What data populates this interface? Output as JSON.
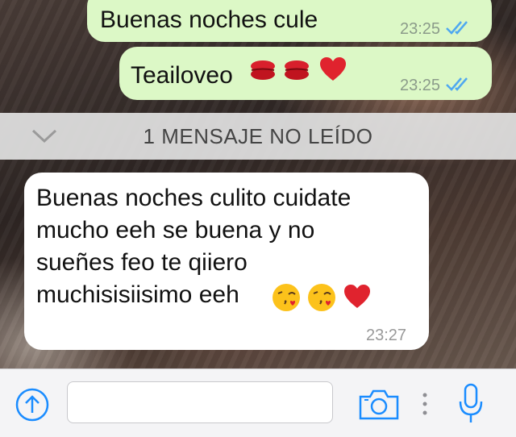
{
  "messages": [
    {
      "direction": "out",
      "text": "Buenas noches cule",
      "time": "23:25",
      "read": true
    },
    {
      "direction": "out",
      "text": "Teailoveo",
      "emojis": [
        "kiss-mark",
        "kiss-mark",
        "red-heart"
      ],
      "time": "23:25",
      "read": true
    },
    {
      "direction": "in",
      "lines": [
        "Buenas noches culito cuidate",
        "mucho eeh se buena y no",
        "sueñes feo te qiiero",
        "muchisisiisimo eeh"
      ],
      "emojis": [
        "face-blowing-kiss",
        "face-blowing-kiss",
        "red-heart"
      ],
      "time": "23:27"
    }
  ],
  "unread_banner": {
    "text": "1 MENSAJE NO LEÍDO",
    "icon": "chevron-down-icon"
  },
  "input_bar": {
    "placeholder": "",
    "icons": [
      "share-up-icon",
      "camera-icon",
      "more-dots-icon",
      "microphone-icon"
    ]
  },
  "colors": {
    "outgoing_bubble": "#dcf8c6",
    "incoming_bubble": "#ffffff",
    "tick_blue": "#4fa8f0",
    "accent": "#1a8cff"
  }
}
